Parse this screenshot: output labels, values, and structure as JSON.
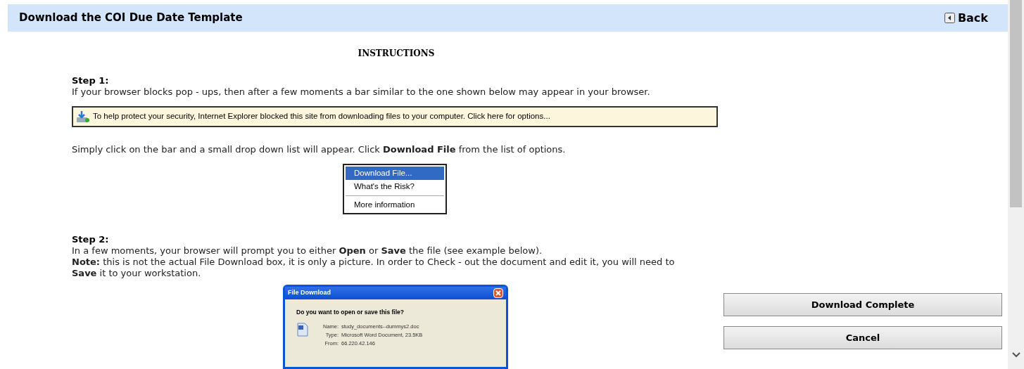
{
  "header": {
    "title": "Download the COI Due Date Template",
    "back": "Back"
  },
  "instructions": {
    "heading": "INSTRUCTIONS",
    "blocks": [
      {
        "kind": "step",
        "text": "Step 1:"
      },
      {
        "kind": "paragraph",
        "text": "If your browser blocks pop - ups, then after a few moments a bar similar to the one shown below may appear in your browser."
      },
      {
        "kind": "infobar",
        "text": "To help protect your security, Internet Explorer blocked this site from downloading files to your computer. Click here for options..."
      },
      {
        "kind": "paragraph",
        "text": "Simply click on the bar and a small drop down list will appear. Click **Download File** from the list of options."
      },
      {
        "kind": "menu",
        "items": [
          {
            "label": "Download File...",
            "selected": true,
            "separator_after": false
          },
          {
            "label": "What's the Risk?",
            "selected": false,
            "separator_after": true
          },
          {
            "label": "More information",
            "selected": false,
            "separator_after": false
          }
        ]
      },
      {
        "kind": "step",
        "text": "Step 2:"
      },
      {
        "kind": "paragraph",
        "text": "In a few moments, your browser will prompt you to either **Open** or **Save** the file (see example below)."
      },
      {
        "kind": "paragraph",
        "text": "**Note:** this is not the actual File Download box, it is only a picture. In order to Check - out the document and edit it, you will need to **Save** it to your workstation."
      },
      {
        "kind": "dialog",
        "title": "File Download",
        "question": "Do you want to open or save this file?",
        "fields": [
          {
            "label": "Name:",
            "value": "study_documents--dummys2.doc"
          },
          {
            "label": "Type:",
            "value": "Microsoft Word Document, 23.5KB"
          },
          {
            "label": "From:",
            "value": "66.220.42.146"
          }
        ]
      }
    ]
  },
  "buttons": [
    "Download Complete",
    "Cancel"
  ]
}
